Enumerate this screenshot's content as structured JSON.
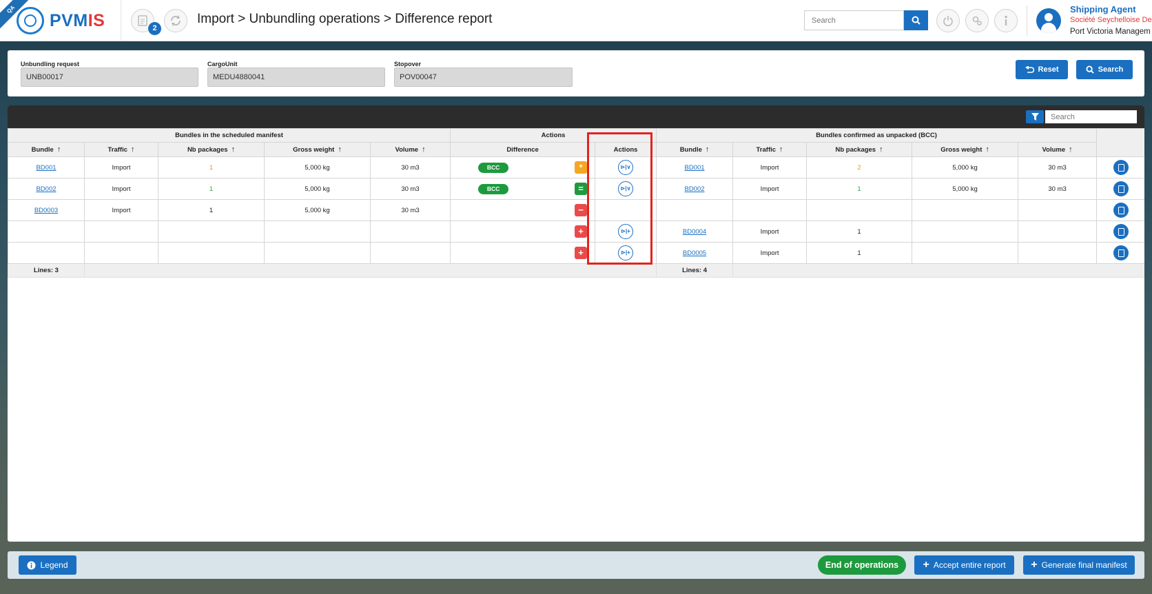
{
  "header": {
    "env_badge": "QA",
    "logo_text_a": "PVM",
    "logo_text_b": "IS",
    "notification_count": "2",
    "breadcrumb": "Import > Unbundling operations > Difference report",
    "search_placeholder": "Search",
    "user": {
      "role": "Shipping Agent",
      "company": "Société Seychelloise De",
      "organization": "Port Victoria Managem"
    }
  },
  "filters": {
    "unbundling_request": {
      "label": "Unbundling request",
      "value": "UNB00017"
    },
    "cargo_unit": {
      "label": "CargoUnit",
      "value": "MEDU4880041"
    },
    "stopover": {
      "label": "Stopover",
      "value": "POV00047"
    },
    "reset_label": "Reset",
    "search_label": "Search"
  },
  "table": {
    "search_placeholder": "Search",
    "group_headers": {
      "left": "Bundles in the scheduled manifest",
      "middle": "Actions",
      "right": "Bundles confirmed as unpacked (BCC)"
    },
    "columns": {
      "bundle": "Bundle",
      "traffic": "Traffic",
      "nb_packages": "Nb packages",
      "gross_weight": "Gross weight",
      "volume": "Volume",
      "difference": "Difference",
      "actions": "Actions"
    },
    "rows": [
      {
        "l_bundle": "BD001",
        "l_traffic": "Import",
        "l_nb": "1",
        "l_weight": "5,000 kg",
        "l_volume": "30 m3",
        "pill": "BCC",
        "diff_sign": "*",
        "action": "⊳|∨",
        "r_bundle": "BD001",
        "r_traffic": "Import",
        "r_nb": "2",
        "r_weight": "5,000 kg",
        "r_volume": "30 m3"
      },
      {
        "l_bundle": "BD002",
        "l_traffic": "Import",
        "l_nb": "1",
        "l_weight": "5,000 kg",
        "l_volume": "30 m3",
        "pill": "BCC",
        "diff_sign": "=",
        "action": "⊳|∨",
        "r_bundle": "BD002",
        "r_traffic": "Import",
        "r_nb": "1",
        "r_weight": "5,000 kg",
        "r_volume": "30 m3"
      },
      {
        "l_bundle": "BD0003",
        "l_traffic": "Import",
        "l_nb": "1",
        "l_weight": "5,000 kg",
        "l_volume": "30 m3",
        "pill": "",
        "diff_sign": "−",
        "action": "",
        "r_bundle": "",
        "r_traffic": "",
        "r_nb": "",
        "r_weight": "",
        "r_volume": ""
      },
      {
        "l_bundle": "",
        "l_traffic": "",
        "l_nb": "",
        "l_weight": "",
        "l_volume": "",
        "pill": "",
        "diff_sign": "+",
        "action": "⊳|+",
        "r_bundle": "BD0004",
        "r_traffic": "Import",
        "r_nb": "1",
        "r_weight": "",
        "r_volume": ""
      },
      {
        "l_bundle": "",
        "l_traffic": "",
        "l_nb": "",
        "l_weight": "",
        "l_volume": "",
        "pill": "",
        "diff_sign": "+",
        "action": "⊳|+",
        "r_bundle": "BD0005",
        "r_traffic": "Import",
        "r_nb": "1",
        "r_weight": "",
        "r_volume": ""
      }
    ],
    "footer": {
      "left_lines": "Lines: 3",
      "right_lines": "Lines: 4"
    }
  },
  "bottom": {
    "legend_label": "Legend",
    "end_operations_label": "End of operations",
    "accept_label": "Accept entire report",
    "generate_label": "Generate final manifest"
  },
  "colors": {
    "primary": "#1a6fc1",
    "success": "#1e9a3e",
    "danger": "#e94b4b",
    "warning": "#f5a623",
    "highlight": "#e3231c"
  }
}
